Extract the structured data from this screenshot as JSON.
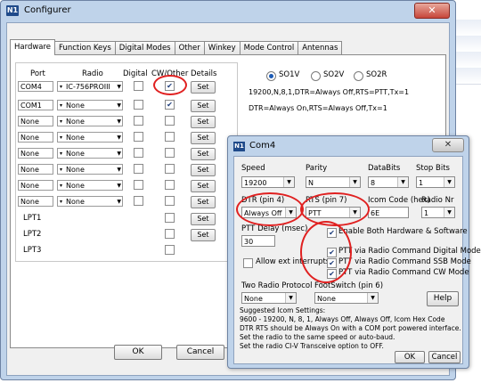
{
  "app": {
    "title": "Configurer",
    "icon": "app-icon",
    "close_symbol": "✕"
  },
  "tabs": [
    {
      "label": "Hardware",
      "active": true
    },
    {
      "label": "Function Keys",
      "active": false
    },
    {
      "label": "Digital Modes",
      "active": false
    },
    {
      "label": "Other",
      "active": false
    },
    {
      "label": "Winkey",
      "active": false
    },
    {
      "label": "Mode Control",
      "active": false
    },
    {
      "label": "Antennas",
      "active": false
    }
  ],
  "ports_table": {
    "headers": {
      "port": "Port",
      "radio": "Radio",
      "digital": "Digital",
      "cw_other": "CW/Other",
      "details": "Details"
    },
    "rows": [
      {
        "port": "COM4",
        "radio": "IC-756PROIII",
        "digital": false,
        "cw": true,
        "set": "Set"
      },
      {
        "port": "COM1",
        "radio": "None",
        "digital": false,
        "cw": true,
        "set": "Set"
      },
      {
        "port": "None",
        "radio": "None",
        "digital": false,
        "cw": false,
        "set": "Set"
      },
      {
        "port": "None",
        "radio": "None",
        "digital": false,
        "cw": false,
        "set": "Set"
      },
      {
        "port": "None",
        "radio": "None",
        "digital": false,
        "cw": false,
        "set": "Set"
      },
      {
        "port": "None",
        "radio": "None",
        "digital": false,
        "cw": false,
        "set": "Set"
      },
      {
        "port": "None",
        "radio": "None",
        "digital": false,
        "cw": false,
        "set": "Set"
      },
      {
        "port": "None",
        "radio": "None",
        "digital": false,
        "cw": false,
        "set": "Set"
      }
    ],
    "lpt": [
      {
        "label": "LPT1",
        "set": "Set"
      },
      {
        "label": "LPT2",
        "set": "Set"
      },
      {
        "label": "LPT3",
        "set": "Set"
      }
    ]
  },
  "so_options": {
    "so1v": "SO1V",
    "so2v": "SO2V",
    "so2r": "SO2R",
    "selected": "SO1V"
  },
  "port_summaries": {
    "line1": "19200,N,8,1,DTR=Always Off,RTS=PTT,Tx=1",
    "line2": "DTR=Always On,RTS=Always Off,Tx=1"
  },
  "buttons": {
    "ok": "OK",
    "cancel": "Cancel"
  },
  "com4_dialog": {
    "title": "Com4",
    "close_symbol": "✕",
    "speed": {
      "label": "Speed",
      "value": "19200"
    },
    "parity": {
      "label": "Parity",
      "value": "N"
    },
    "databits": {
      "label": "DataBits",
      "value": "8"
    },
    "stopbits": {
      "label": "Stop Bits",
      "value": "1"
    },
    "dtr": {
      "label": "DTR (pin 4)",
      "value": "Always Off"
    },
    "rts": {
      "label": "RTS (pin 7)",
      "value": "PTT"
    },
    "icom_code": {
      "label": "Icom Code (hex)",
      "value": "6E"
    },
    "radio_nr": {
      "label": "Radio Nr",
      "value": "1"
    },
    "ptt_delay": {
      "label": "PTT Delay  (msec)",
      "value": "30"
    },
    "enable_both": {
      "label": "Enable Both Hardware & Software",
      "checked": true
    },
    "allow_ext": {
      "label": "Allow ext interrupts",
      "checked": false
    },
    "ptt_digital": {
      "label": "PTT via Radio Command Digital Mode",
      "checked": true
    },
    "ptt_ssb": {
      "label": "PTT via Radio Command SSB Mode",
      "checked": true
    },
    "ptt_cw": {
      "label": "PTT via Radio Command CW Mode",
      "checked": true
    },
    "two_radio": {
      "label": "Two Radio Protocol",
      "value": "None"
    },
    "footswitch": {
      "label": "FootSwitch (pin 6)",
      "value": "None"
    },
    "help": "Help",
    "suggest_heading": "Suggested Icom Settings:",
    "suggest_lines": [
      "9600 - 19200,  N,  8,  1,  Always Off, Always Off,  Icom Hex Code",
      "DTR  RTS should be Always On with a COM port powered interface.",
      "Set the radio to the same speed or auto-baud.",
      "Set the radio CI-V Transceive option to OFF."
    ],
    "ok": "OK",
    "cancel": "Cancel"
  },
  "colors": {
    "annotation": "#e02020",
    "frame": "#bfd3ea",
    "accent": "#1c5bb5"
  }
}
